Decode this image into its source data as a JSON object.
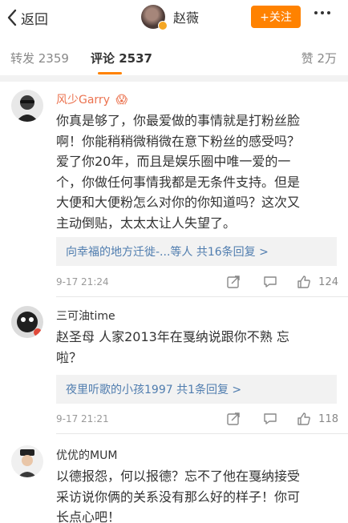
{
  "header": {
    "back_label": "返回",
    "user_name": "赵薇",
    "follow_label": "+关注"
  },
  "tabs": {
    "repost": "转发 2359",
    "comment": "评论 2537",
    "like": "赞 2万"
  },
  "comments": [
    {
      "name": "风少Garry",
      "badge": "😱",
      "lines": [
        "你真是够了，你最爱做的事情就是打粉丝脸",
        "啊！你能稍稍微稍微在意下粉丝的感受吗？",
        "爱了你20年，而且是娱乐圈中唯一爱的一",
        "个，你做任何事情我都是无条件支持。但是",
        "大便和大便粉怎么对你的你知道吗？这次又",
        "主动倒贴，太太太让人失望了。"
      ],
      "reply_summary": "向幸福的地方迁徙-...等人 共16条回复 >",
      "time": "9-17 21:24",
      "likes": "124"
    },
    {
      "name": "三可油time",
      "lines": [
        "赵圣母 人家2013年在戛纳说跟你不熟 忘",
        "啦？"
      ],
      "reply_summary": "夜里听歌的小孩1997 共1条回复 >",
      "time": "9-17 21:21",
      "likes": "118"
    },
    {
      "name": "优优的MUM",
      "lines": [
        "以德报怨，何以报德？忘不了他在戛纳接受",
        "采访说你俩的关系没有那么好的样子！你可",
        "长点心吧！"
      ]
    }
  ],
  "colors": {
    "accent": "#ff8200",
    "username_orange": "#eb7350",
    "link_blue": "#507daf"
  },
  "icons": {
    "back": "chevron-left-icon",
    "more": "more-dots-icon",
    "verified": "verified-badge-icon",
    "share": "share-icon",
    "comment": "comment-icon",
    "like": "thumbs-up-icon"
  }
}
